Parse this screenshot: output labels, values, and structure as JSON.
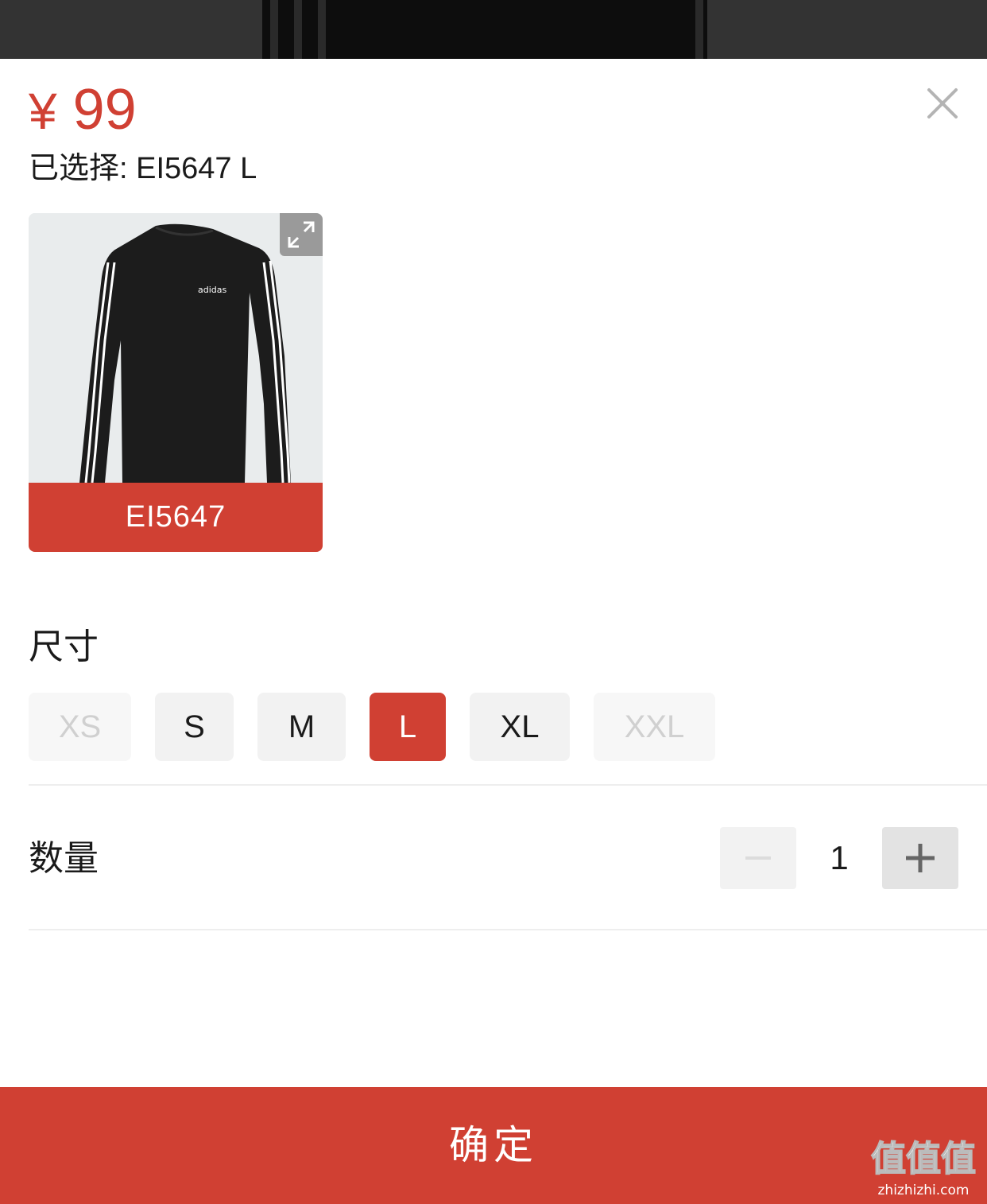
{
  "header": {
    "currency_symbol": "¥",
    "price": "99",
    "selected_text": "已选择: EI5647 L"
  },
  "variant": {
    "code": "EI5647",
    "logo_text": "adidas"
  },
  "size": {
    "title": "尺寸",
    "options": [
      {
        "label": "XS",
        "state": "disabled"
      },
      {
        "label": "S",
        "state": "available"
      },
      {
        "label": "M",
        "state": "available"
      },
      {
        "label": "L",
        "state": "selected"
      },
      {
        "label": "XL",
        "state": "available"
      },
      {
        "label": "XXL",
        "state": "disabled"
      }
    ]
  },
  "quantity": {
    "title": "数量",
    "value": "1"
  },
  "confirm": {
    "label": "确定"
  },
  "watermark": {
    "text": "值值值",
    "site": "zhizhizhi.com"
  },
  "colors": {
    "accent": "#d04033",
    "option_bg": "#f2f2f2",
    "disabled_text": "#d0d0d0"
  },
  "icons": [
    "close-icon",
    "expand-icon",
    "minus-icon",
    "plus-icon"
  ]
}
